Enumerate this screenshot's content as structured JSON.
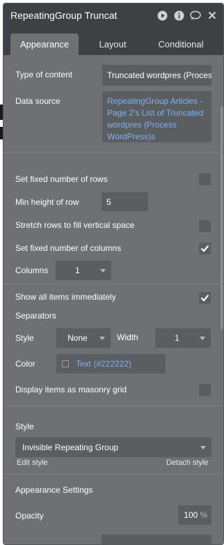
{
  "panel": {
    "title": "RepeatingGroup Truncat",
    "tabs": [
      "Appearance",
      "Layout",
      "Conditional"
    ]
  },
  "fields": {
    "type_of_content": {
      "label": "Type of content",
      "value": "Truncated wordpres (Process"
    },
    "data_source": {
      "label": "Data source",
      "value": "RepeatingGroup Articles - Page 2's List of Truncated wordpres (Process WordPress)s"
    },
    "fixed_rows": {
      "label": "Set fixed number of rows",
      "checked": false
    },
    "min_height": {
      "label": "Min height of row",
      "value": "5"
    },
    "stretch_rows": {
      "label": "Stretch rows to fill vertical space",
      "checked": false
    },
    "fixed_columns": {
      "label": "Set fixed number of columns",
      "checked": true
    },
    "columns": {
      "label": "Columns",
      "value": "1"
    },
    "show_all": {
      "label": "Show all items immediately",
      "checked": true
    },
    "separators": {
      "label": "Separators"
    },
    "sep_style": {
      "label": "Style",
      "value": "None"
    },
    "sep_width": {
      "label": "Width",
      "value": "1"
    },
    "sep_color": {
      "label": "Color",
      "value": "Text (#222222)"
    },
    "masonry": {
      "label": "Display items as masonry grid",
      "checked": false
    },
    "style": {
      "label": "Style",
      "value": "Invisible Repeating Group",
      "edit": "Edit style",
      "detach": "Detach style"
    },
    "appearance_settings": {
      "label": "Appearance Settings"
    },
    "opacity": {
      "label": "Opacity",
      "value": "100",
      "unit": "%"
    }
  },
  "colors": {
    "link": "#7fb2f0",
    "panel": "#6e7073",
    "header": "#3e4144"
  }
}
